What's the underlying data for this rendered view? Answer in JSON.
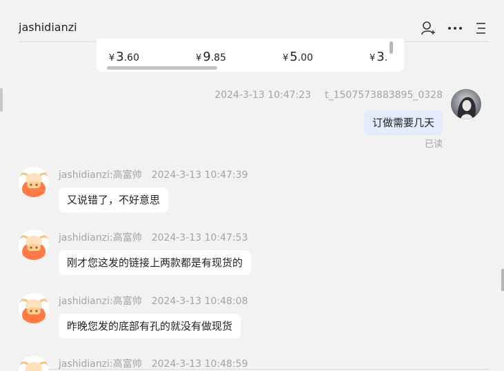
{
  "header": {
    "title": "jashidianzi",
    "icons": [
      "add-user-icon",
      "more-icon",
      "menu-icon"
    ]
  },
  "product_prices": [
    {
      "currency": "¥",
      "integer": "3",
      "decimal": ".60"
    },
    {
      "currency": "¥",
      "integer": "9",
      "decimal": ".85"
    },
    {
      "currency": "¥",
      "integer": "5",
      "decimal": ".00"
    },
    {
      "currency": "¥",
      "integer": "3",
      "decimal": "."
    }
  ],
  "self_message": {
    "timestamp": "2024-3-13 10:47:23",
    "sender": "t_1507573883895_0328",
    "text": "订做需要几天",
    "status": "已读"
  },
  "messages": [
    {
      "sender": "jashidianzi:高富帅",
      "timestamp": "2024-3-13 10:47:39",
      "text": "又说错了，不好意思"
    },
    {
      "sender": "jashidianzi:高富帅",
      "timestamp": "2024-3-13 10:47:53",
      "text": "刚才您这发的链接上两款都是有现货的"
    },
    {
      "sender": "jashidianzi:高富帅",
      "timestamp": "2024-3-13 10:48:08",
      "text": "昨晚您发的底部有孔的就没有做现货"
    },
    {
      "sender": "jashidianzi:高富帅",
      "timestamp": "2024-3-13 10:48:59",
      "text": ""
    }
  ],
  "colors": {
    "background": "#f2f2f3",
    "self_bubble": "#e4ecfb",
    "other_bubble": "#ffffff",
    "meta_text": "#a3a3a8",
    "avatar_orange": "#ff7a45"
  }
}
